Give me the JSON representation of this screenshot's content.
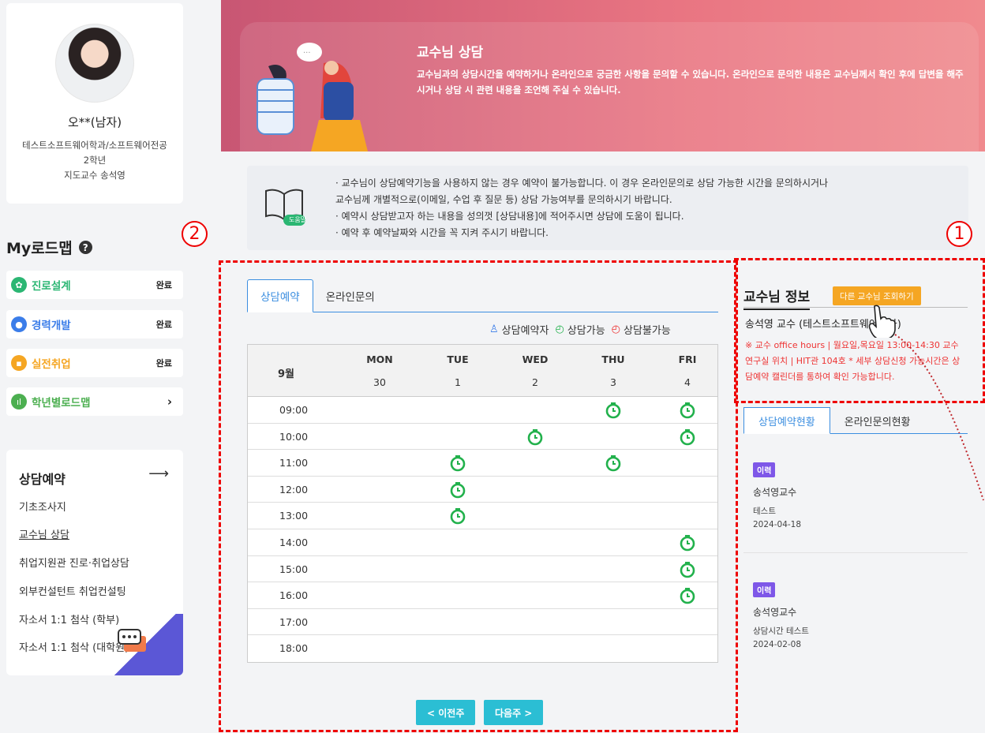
{
  "profile": {
    "name": "오**(남자)",
    "department": "테스트소프트웨어학과/소프트웨어전공",
    "grade": "2학년",
    "advisor": "지도교수 송석영"
  },
  "roadmap": {
    "title": "My로드맵",
    "items": [
      {
        "label": "진로설계",
        "status": "완료",
        "color": "#2bb673"
      },
      {
        "label": "경력개발",
        "status": "완료",
        "color": "#3b7de9"
      },
      {
        "label": "실전취업",
        "status": "완료",
        "color": "#f5a623"
      },
      {
        "label": "학년별로드맵",
        "status": "›",
        "color": "#4caf50"
      }
    ]
  },
  "menu": {
    "title": "상담예약",
    "arrow": "⟶",
    "items": [
      "기초조사지",
      "교수님 상담",
      "취업지원관 진로·취업상담",
      "외부컨설턴트 취업컨설팅",
      "자소서 1:1 첨삭 (학부)",
      "자소서 1:1 첨삭 (대학원)"
    ]
  },
  "banner": {
    "title": "교수님 상담",
    "description": "교수님과의 상담시간을 예약하거나 온라인으로 궁금한 사항을 문의할 수 있습니다. 온라인으로 문의한 내용은 교수님께서 확인 후에 답변을 해주시거나 상담 시 관련 내용을 조언해 주실 수 있습니다."
  },
  "notice": {
    "icon_label": "도움말",
    "lines": [
      "· 교수님이 상담예약기능을 사용하지 않는 경우 예약이 불가능합니다. 이 경우 온라인문의로 상담 가능한 시간을 문의하시거나",
      "교수님께 개별적으로(이메일, 수업 후 질문 등) 상담 가능여부를 문의하시기 바랍니다.",
      "· 예약시 상담받고자 하는 내용을 성의껏 [상담내용]에 적어주시면 상담에 도움이 됩니다.",
      "· 예약 후 예약날짜와 시간을 꼭 지켜 주시기 바랍니다."
    ]
  },
  "markers": {
    "one": "1",
    "two": "2"
  },
  "tabs": [
    "상담예약",
    "온라인문의"
  ],
  "legend": {
    "reserver": "상담예약자",
    "available": "상담가능",
    "unavailable": "상담불가능"
  },
  "schedule": {
    "month": "9월",
    "days": [
      {
        "dow": "MON",
        "date": "30"
      },
      {
        "dow": "TUE",
        "date": "1"
      },
      {
        "dow": "WED",
        "date": "2"
      },
      {
        "dow": "THU",
        "date": "3"
      },
      {
        "dow": "FRI",
        "date": "4"
      }
    ],
    "times": [
      "09:00",
      "10:00",
      "11:00",
      "12:00",
      "13:00",
      "14:00",
      "15:00",
      "16:00",
      "17:00",
      "18:00"
    ],
    "available": [
      {
        "time": "09:00",
        "day": "THU"
      },
      {
        "time": "09:00",
        "day": "FRI"
      },
      {
        "time": "10:00",
        "day": "WED"
      },
      {
        "time": "10:00",
        "day": "FRI"
      },
      {
        "time": "11:00",
        "day": "TUE"
      },
      {
        "time": "11:00",
        "day": "THU"
      },
      {
        "time": "12:00",
        "day": "TUE"
      },
      {
        "time": "13:00",
        "day": "TUE"
      },
      {
        "time": "14:00",
        "day": "FRI"
      },
      {
        "time": "15:00",
        "day": "FRI"
      },
      {
        "time": "16:00",
        "day": "FRI"
      }
    ]
  },
  "pager": {
    "prev": "< 이전주",
    "next": "다음주 >"
  },
  "professor": {
    "section_title": "교수님 정보",
    "other_button": "다른 교수님 조회하기",
    "name": "송석영 교수 (테스트소프트웨어학과)",
    "office_hours": "※ 교수 office hours | 월요일,목요일 13:00-14:30 교수 연구실 위치 | HIT관 104호 * 세부 상담신청 가능시간은 상담예약 캘린더를 통하여 확인 가능합니다."
  },
  "history_tabs": [
    "상담예약현황",
    "온라인문의현황"
  ],
  "history": [
    {
      "badge": "이력",
      "name": "송석영교수",
      "title": "테스트",
      "date": "2024-04-18"
    },
    {
      "badge": "이력",
      "name": "송석영교수",
      "title": "상담시간 테스트",
      "date": "2024-02-08"
    }
  ],
  "colors": {
    "accent": "#3b8ee0",
    "available": "#22b14c",
    "unavailable": "#e33",
    "marker": "#e00"
  }
}
